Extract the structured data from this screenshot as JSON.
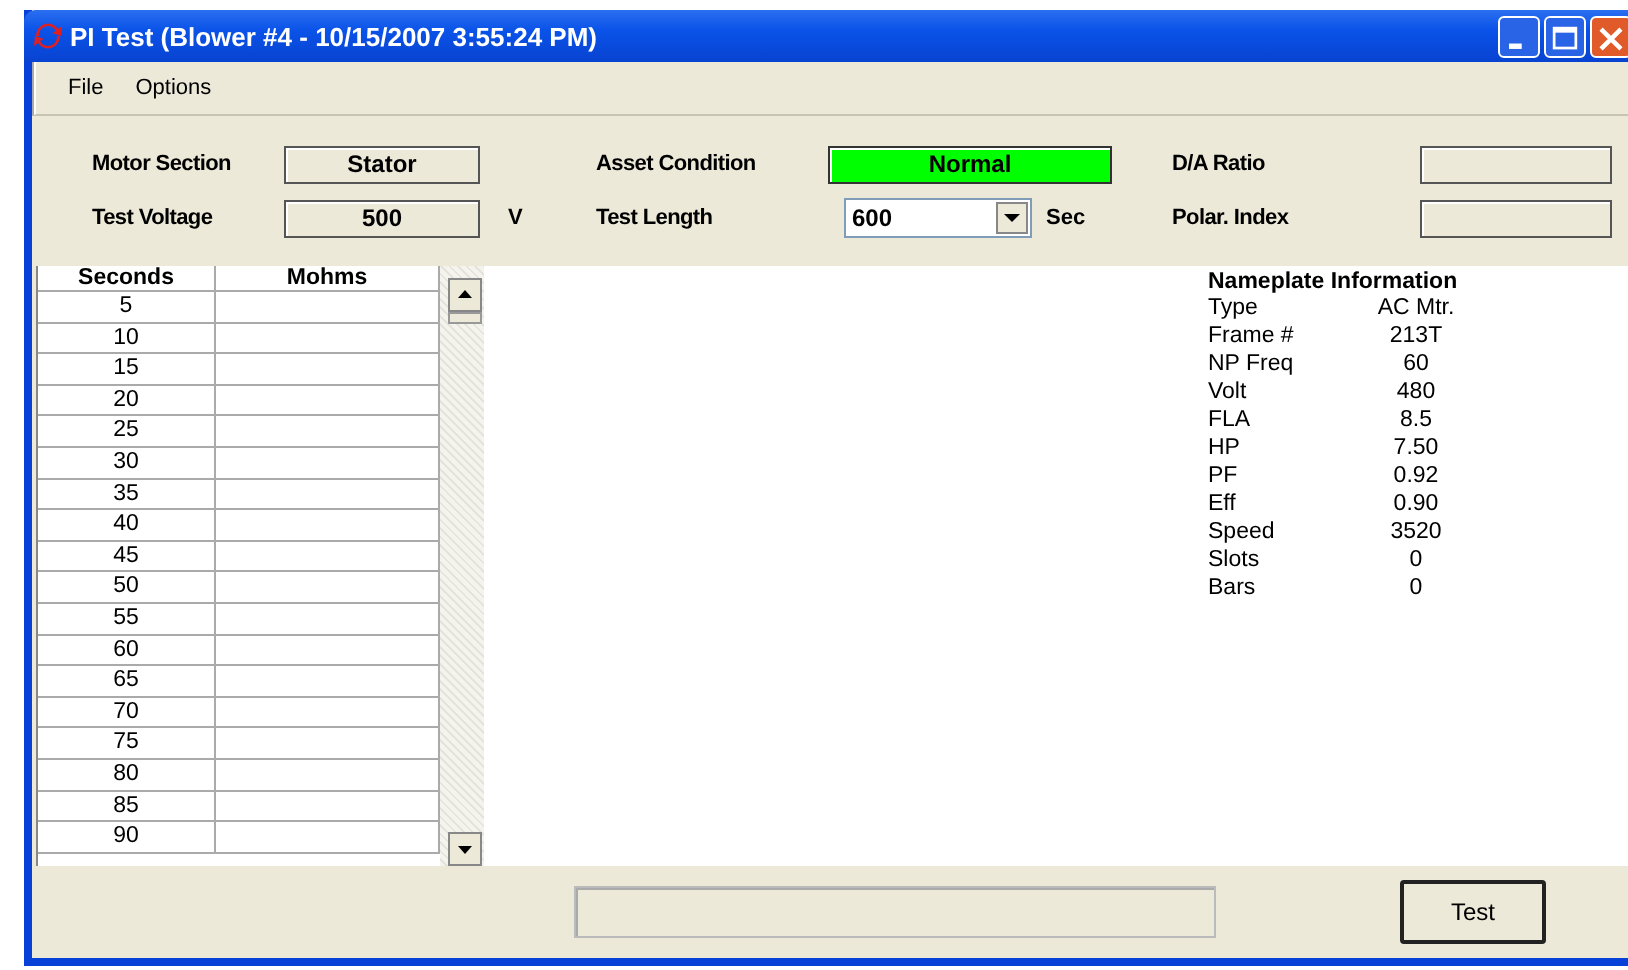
{
  "window": {
    "title": "PI Test (Blower #4 - 10/15/2007 3:55:24 PM)"
  },
  "menu": [
    "File",
    "Options"
  ],
  "fields": [
    {
      "label": "Motor Section",
      "value": "Stator"
    },
    {
      "label": "Asset Condition",
      "value": "Normal",
      "color": "#00ff00"
    },
    {
      "label": "D/A Ratio"
    },
    {
      "label": "Test Voltage",
      "value": "500",
      "unit": "V"
    },
    {
      "label": "Test Length",
      "value": "600",
      "unit": "Sec",
      "kind": "dropdown"
    },
    {
      "label": "Polar. Index"
    }
  ],
  "table": {
    "columns": [
      "Seconds",
      "Mohms"
    ],
    "rows": [
      "5",
      "10",
      "15",
      "20",
      "25",
      "30",
      "35",
      "40",
      "45",
      "50",
      "55",
      "60",
      "65",
      "70",
      "75",
      "80",
      "85",
      "90"
    ]
  },
  "nameplate": {
    "title": "Nameplate Information",
    "rows": [
      {
        "label": "Type",
        "value": "AC Mtr."
      },
      {
        "label": "Frame #",
        "value": "213T"
      },
      {
        "label": "NP Freq",
        "value": "60"
      },
      {
        "label": "Volt",
        "value": "480"
      },
      {
        "label": "FLA",
        "value": "8.5"
      },
      {
        "label": "HP",
        "value": "7.50"
      },
      {
        "label": "PF",
        "value": "0.92"
      },
      {
        "label": "Eff",
        "value": "0.90"
      },
      {
        "label": "Speed",
        "value": "3520"
      },
      {
        "label": "Slots",
        "value": "0"
      },
      {
        "label": "Bars",
        "value": "0"
      }
    ]
  },
  "buttons": [
    "Test"
  ]
}
